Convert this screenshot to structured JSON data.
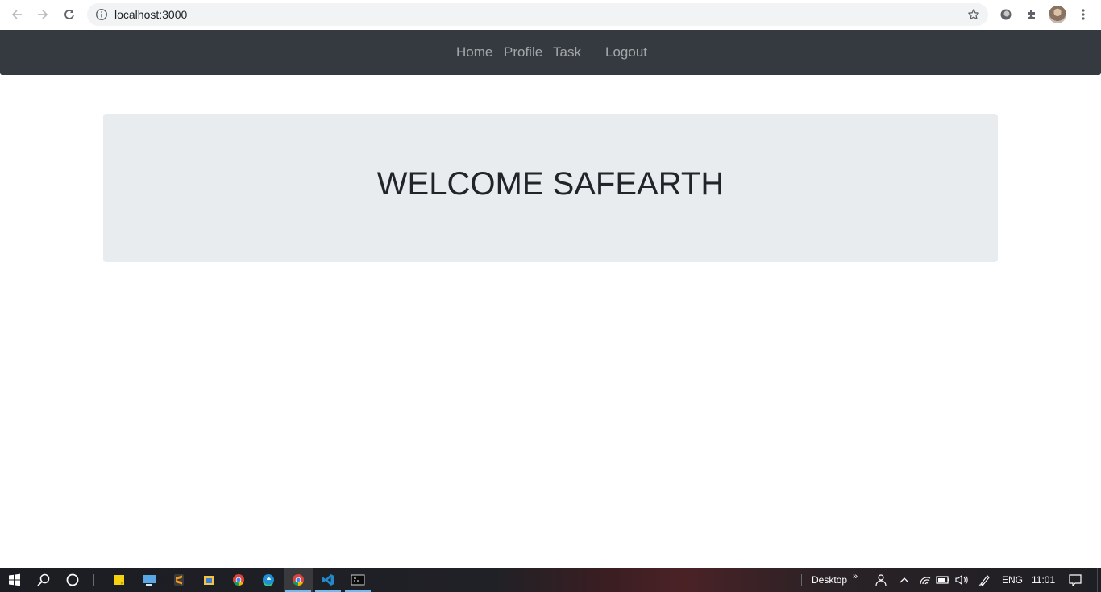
{
  "browser": {
    "url": "localhost:3000",
    "icons": [
      "back-arrow-icon",
      "forward-arrow-icon",
      "reload-icon",
      "site-info-icon",
      "bookmark-star-icon",
      "extension-circle-icon",
      "puzzle-extensions-icon",
      "menu-dots-icon"
    ]
  },
  "navbar": {
    "links": [
      "Home",
      "Profile",
      "Task",
      "Logout"
    ],
    "background": "#343a40",
    "link_color": "rgba(255,255,255,0.55)"
  },
  "jumbotron": {
    "heading": "WELCOME SAFEARTH",
    "background": "#e9ecef"
  },
  "taskbar": {
    "apps": [
      "start-icon",
      "search-icon",
      "cortana-icon",
      "sticky-notes-icon",
      "remote-desktop-icon",
      "sublime-text-icon",
      "file-explorer-icon",
      "chrome-icon",
      "edge-icon",
      "chrome-active-icon",
      "vscode-icon",
      "terminal-icon"
    ],
    "desktop_label": "Desktop",
    "language": "ENG",
    "time": "11:01"
  }
}
